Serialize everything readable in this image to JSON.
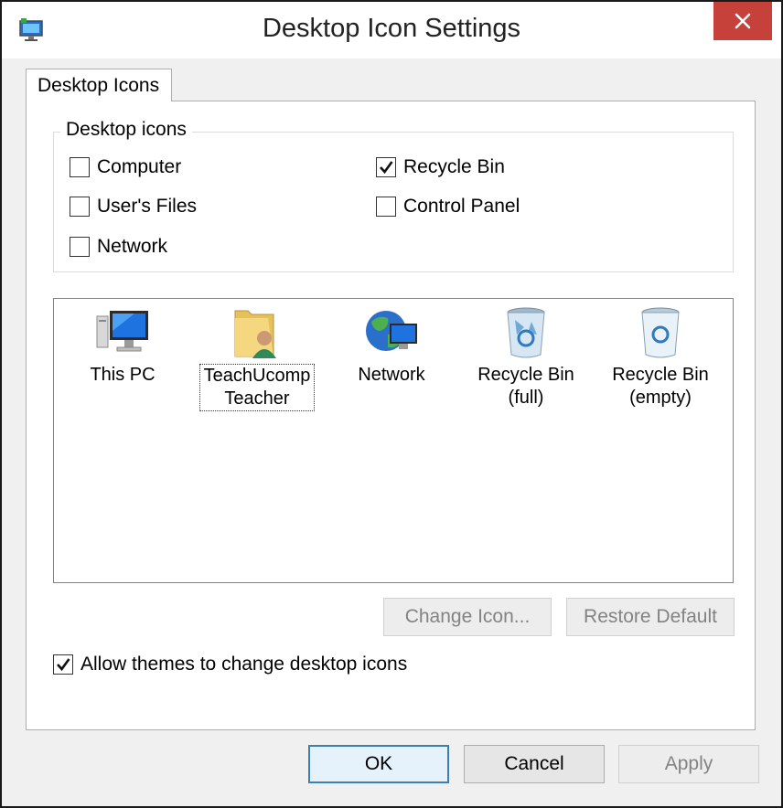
{
  "window": {
    "title": "Desktop Icon Settings"
  },
  "tabs": [
    {
      "label": "Desktop Icons"
    }
  ],
  "group": {
    "legend": "Desktop icons",
    "checkboxes": [
      {
        "label": "Computer",
        "checked": false
      },
      {
        "label": "User's Files",
        "checked": false
      },
      {
        "label": "Network",
        "checked": false
      },
      {
        "label": "Recycle Bin",
        "checked": true
      },
      {
        "label": "Control Panel",
        "checked": false
      }
    ]
  },
  "icon_list": [
    {
      "label": "This PC",
      "icon": "this-pc-icon"
    },
    {
      "label": "TeachUcomp Teacher",
      "icon": "user-folder-icon",
      "selected": true
    },
    {
      "label": "Network",
      "icon": "network-globe-icon"
    },
    {
      "label": "Recycle Bin (full)",
      "icon": "recycle-bin-full-icon"
    },
    {
      "label": "Recycle Bin (empty)",
      "icon": "recycle-bin-empty-icon"
    }
  ],
  "buttons": {
    "change_icon": "Change Icon...",
    "restore_default": "Restore Default",
    "ok": "OK",
    "cancel": "Cancel",
    "apply": "Apply"
  },
  "themes_checkbox": {
    "label": "Allow themes to change desktop icons",
    "checked": true
  },
  "colors": {
    "close_button": "#c7413b",
    "default_button_border": "#3c7fb1"
  }
}
